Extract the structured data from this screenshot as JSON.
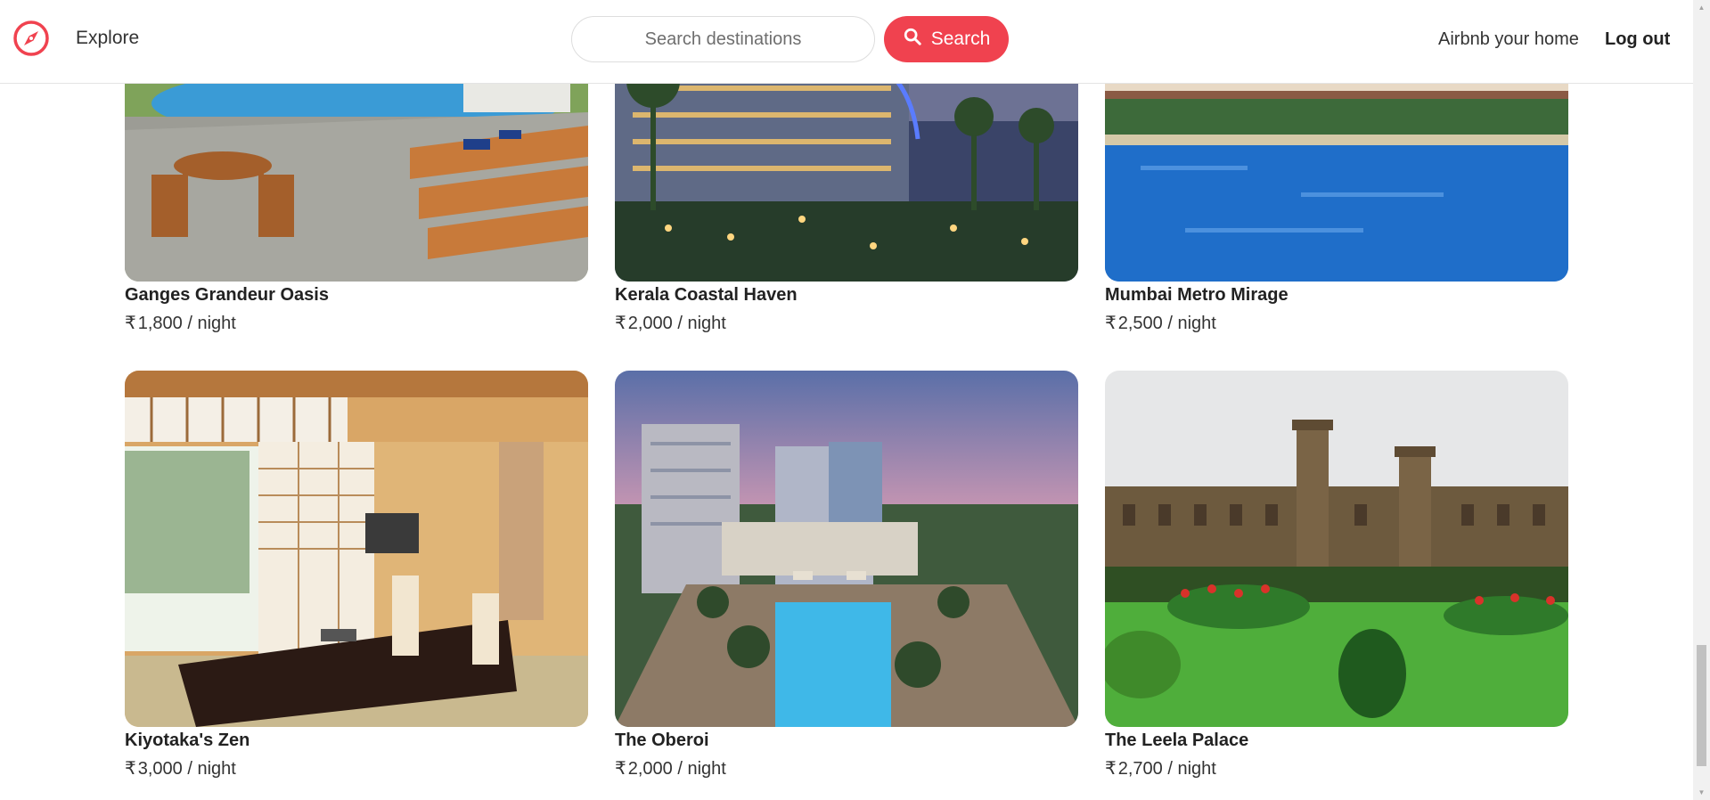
{
  "header": {
    "explore_label": "Explore",
    "search_placeholder": "Search destinations",
    "search_button_label": "Search",
    "host_link_label": "Airbnb your home",
    "logout_label": "Log out",
    "brand_color": "#f0424f",
    "logo_icon": "compass-icon",
    "search_icon": "search-icon"
  },
  "listings": [
    {
      "name": "Ganges Grandeur Oasis",
      "currency": "₹",
      "price": "1,800",
      "unit": "/ night",
      "image": "resort-pool-loungers"
    },
    {
      "name": "Kerala Coastal Haven",
      "currency": "₹",
      "price": "2,000",
      "unit": "/ night",
      "image": "curved-hotel-night"
    },
    {
      "name": "Mumbai Metro Mirage",
      "currency": "₹",
      "price": "2,500",
      "unit": "/ night",
      "image": "heritage-building-pool"
    },
    {
      "name": "Kiyotaka's Zen",
      "currency": "₹",
      "price": "3,000",
      "unit": "/ night",
      "image": "japanese-tatami-room"
    },
    {
      "name": "The Oberoi",
      "currency": "₹",
      "price": "2,000",
      "unit": "/ night",
      "image": "hotel-pool-sunset"
    },
    {
      "name": "The Leela Palace",
      "currency": "₹",
      "price": "2,700",
      "unit": "/ night",
      "image": "palace-garden"
    }
  ],
  "scrollbar": {
    "scroll_fraction": 0.95
  }
}
